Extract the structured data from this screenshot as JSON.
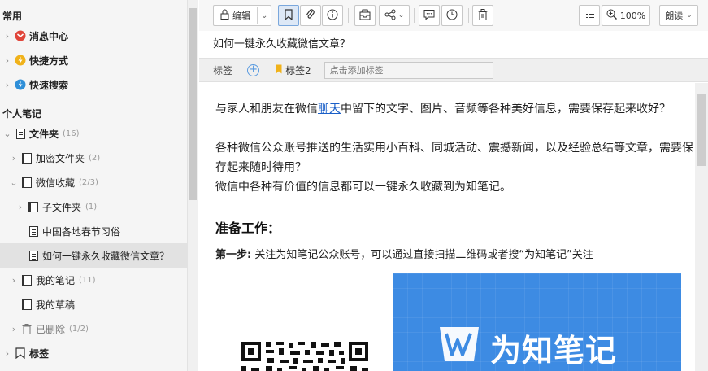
{
  "sidebar": {
    "section_common": "常用",
    "common_items": [
      {
        "label": "消息中心",
        "icon": "message-center-icon",
        "color": "#e0453a"
      },
      {
        "label": "快捷方式",
        "icon": "shortcut-icon",
        "color": "#f0b21a"
      },
      {
        "label": "快速搜索",
        "icon": "quick-search-icon",
        "color": "#2f8fd8"
      }
    ],
    "section_personal": "个人笔记",
    "tree": [
      {
        "label": "文件夹",
        "count": "(16)"
      },
      {
        "label": "加密文件夹",
        "count": "(2)"
      },
      {
        "label": "微信收藏",
        "count": "(2/3)"
      },
      {
        "label": "子文件夹",
        "count": "(1)"
      },
      {
        "label": "中国各地春节习俗",
        "count": ""
      },
      {
        "label": "如何一键永久收藏微信文章？",
        "count": ""
      },
      {
        "label": "我的笔记",
        "count": "(11)"
      },
      {
        "label": "我的草稿",
        "count": ""
      },
      {
        "label": "已删除",
        "count": "(1/2)"
      },
      {
        "label": "标签",
        "count": ""
      }
    ]
  },
  "toolbar": {
    "edit_label": "编辑",
    "zoom_label": "100%",
    "read_label": "朗读"
  },
  "note": {
    "title": "如何一键永久收藏微信文章？",
    "tag_label": "标签",
    "tag_item": "标签2",
    "tag_placeholder": "点击添加标签",
    "para1_a": "与家人和朋友在微信",
    "para1_link": "聊天",
    "para1_b": "中留下的文字、图片、音频等各种美好信息，需要保存起来收好？",
    "para2": "各种微信公众账号推送的生活实用小百科、同城活动、震撼新闻，以及经验总结等文章，需要保存起来随时待用？",
    "para3": "微信中各种有价值的信息都可以一键永久收藏到为知笔记。",
    "heading": "准备工作：",
    "step_bold": "第一步:",
    "step_text": " 关注为知笔记公众账号，可以通过直接扫描二维码或者搜“为知笔记”关注",
    "banner_text": "为知笔记"
  },
  "colors": {
    "accent": "#3d8be3",
    "link": "#1a5fc8",
    "selected_row": "#e2e2e2"
  }
}
